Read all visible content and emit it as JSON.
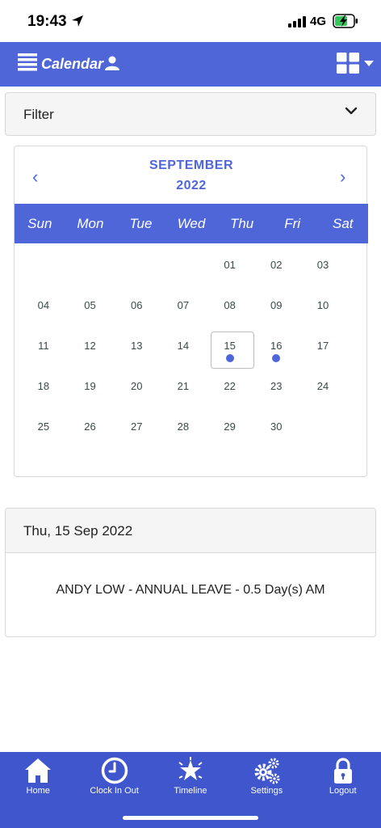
{
  "status_bar": {
    "time": "19:43",
    "network": "4G"
  },
  "header": {
    "title": "Calendar",
    "icons": [
      "menu-icon",
      "user-icon",
      "grid-icon",
      "caret-down-icon"
    ]
  },
  "filter": {
    "label": "Filter"
  },
  "calendar": {
    "month": "SEPTEMBER",
    "year": "2022",
    "prev": "‹",
    "next": "›",
    "weekdays": [
      "Sun",
      "Mon",
      "Tue",
      "Wed",
      "Thu",
      "Fri",
      "Sat"
    ],
    "weeks": [
      [
        "",
        "",
        "",
        "",
        "01",
        "02",
        "03"
      ],
      [
        "04",
        "05",
        "06",
        "07",
        "08",
        "09",
        "10"
      ],
      [
        "11",
        "12",
        "13",
        "14",
        "15",
        "16",
        "17"
      ],
      [
        "18",
        "19",
        "20",
        "21",
        "22",
        "23",
        "24"
      ],
      [
        "25",
        "26",
        "27",
        "28",
        "29",
        "30",
        ""
      ]
    ],
    "selected_day": "15",
    "event_days": [
      "15",
      "16"
    ],
    "accent_color": "#4f66d9"
  },
  "event": {
    "date_heading": "Thu, 15 Sep 2022",
    "description": "ANDY LOW - ANNUAL LEAVE - 0.5 Day(s) AM"
  },
  "bottom_nav": {
    "items": [
      {
        "label": "Home",
        "icon": "home-icon"
      },
      {
        "label": "Clock In Out",
        "icon": "clock-icon"
      },
      {
        "label": "Timeline",
        "icon": "star-icon"
      },
      {
        "label": "Settings",
        "icon": "gears-icon"
      },
      {
        "label": "Logout",
        "icon": "lock-icon"
      }
    ],
    "color": "#3f56cc"
  }
}
